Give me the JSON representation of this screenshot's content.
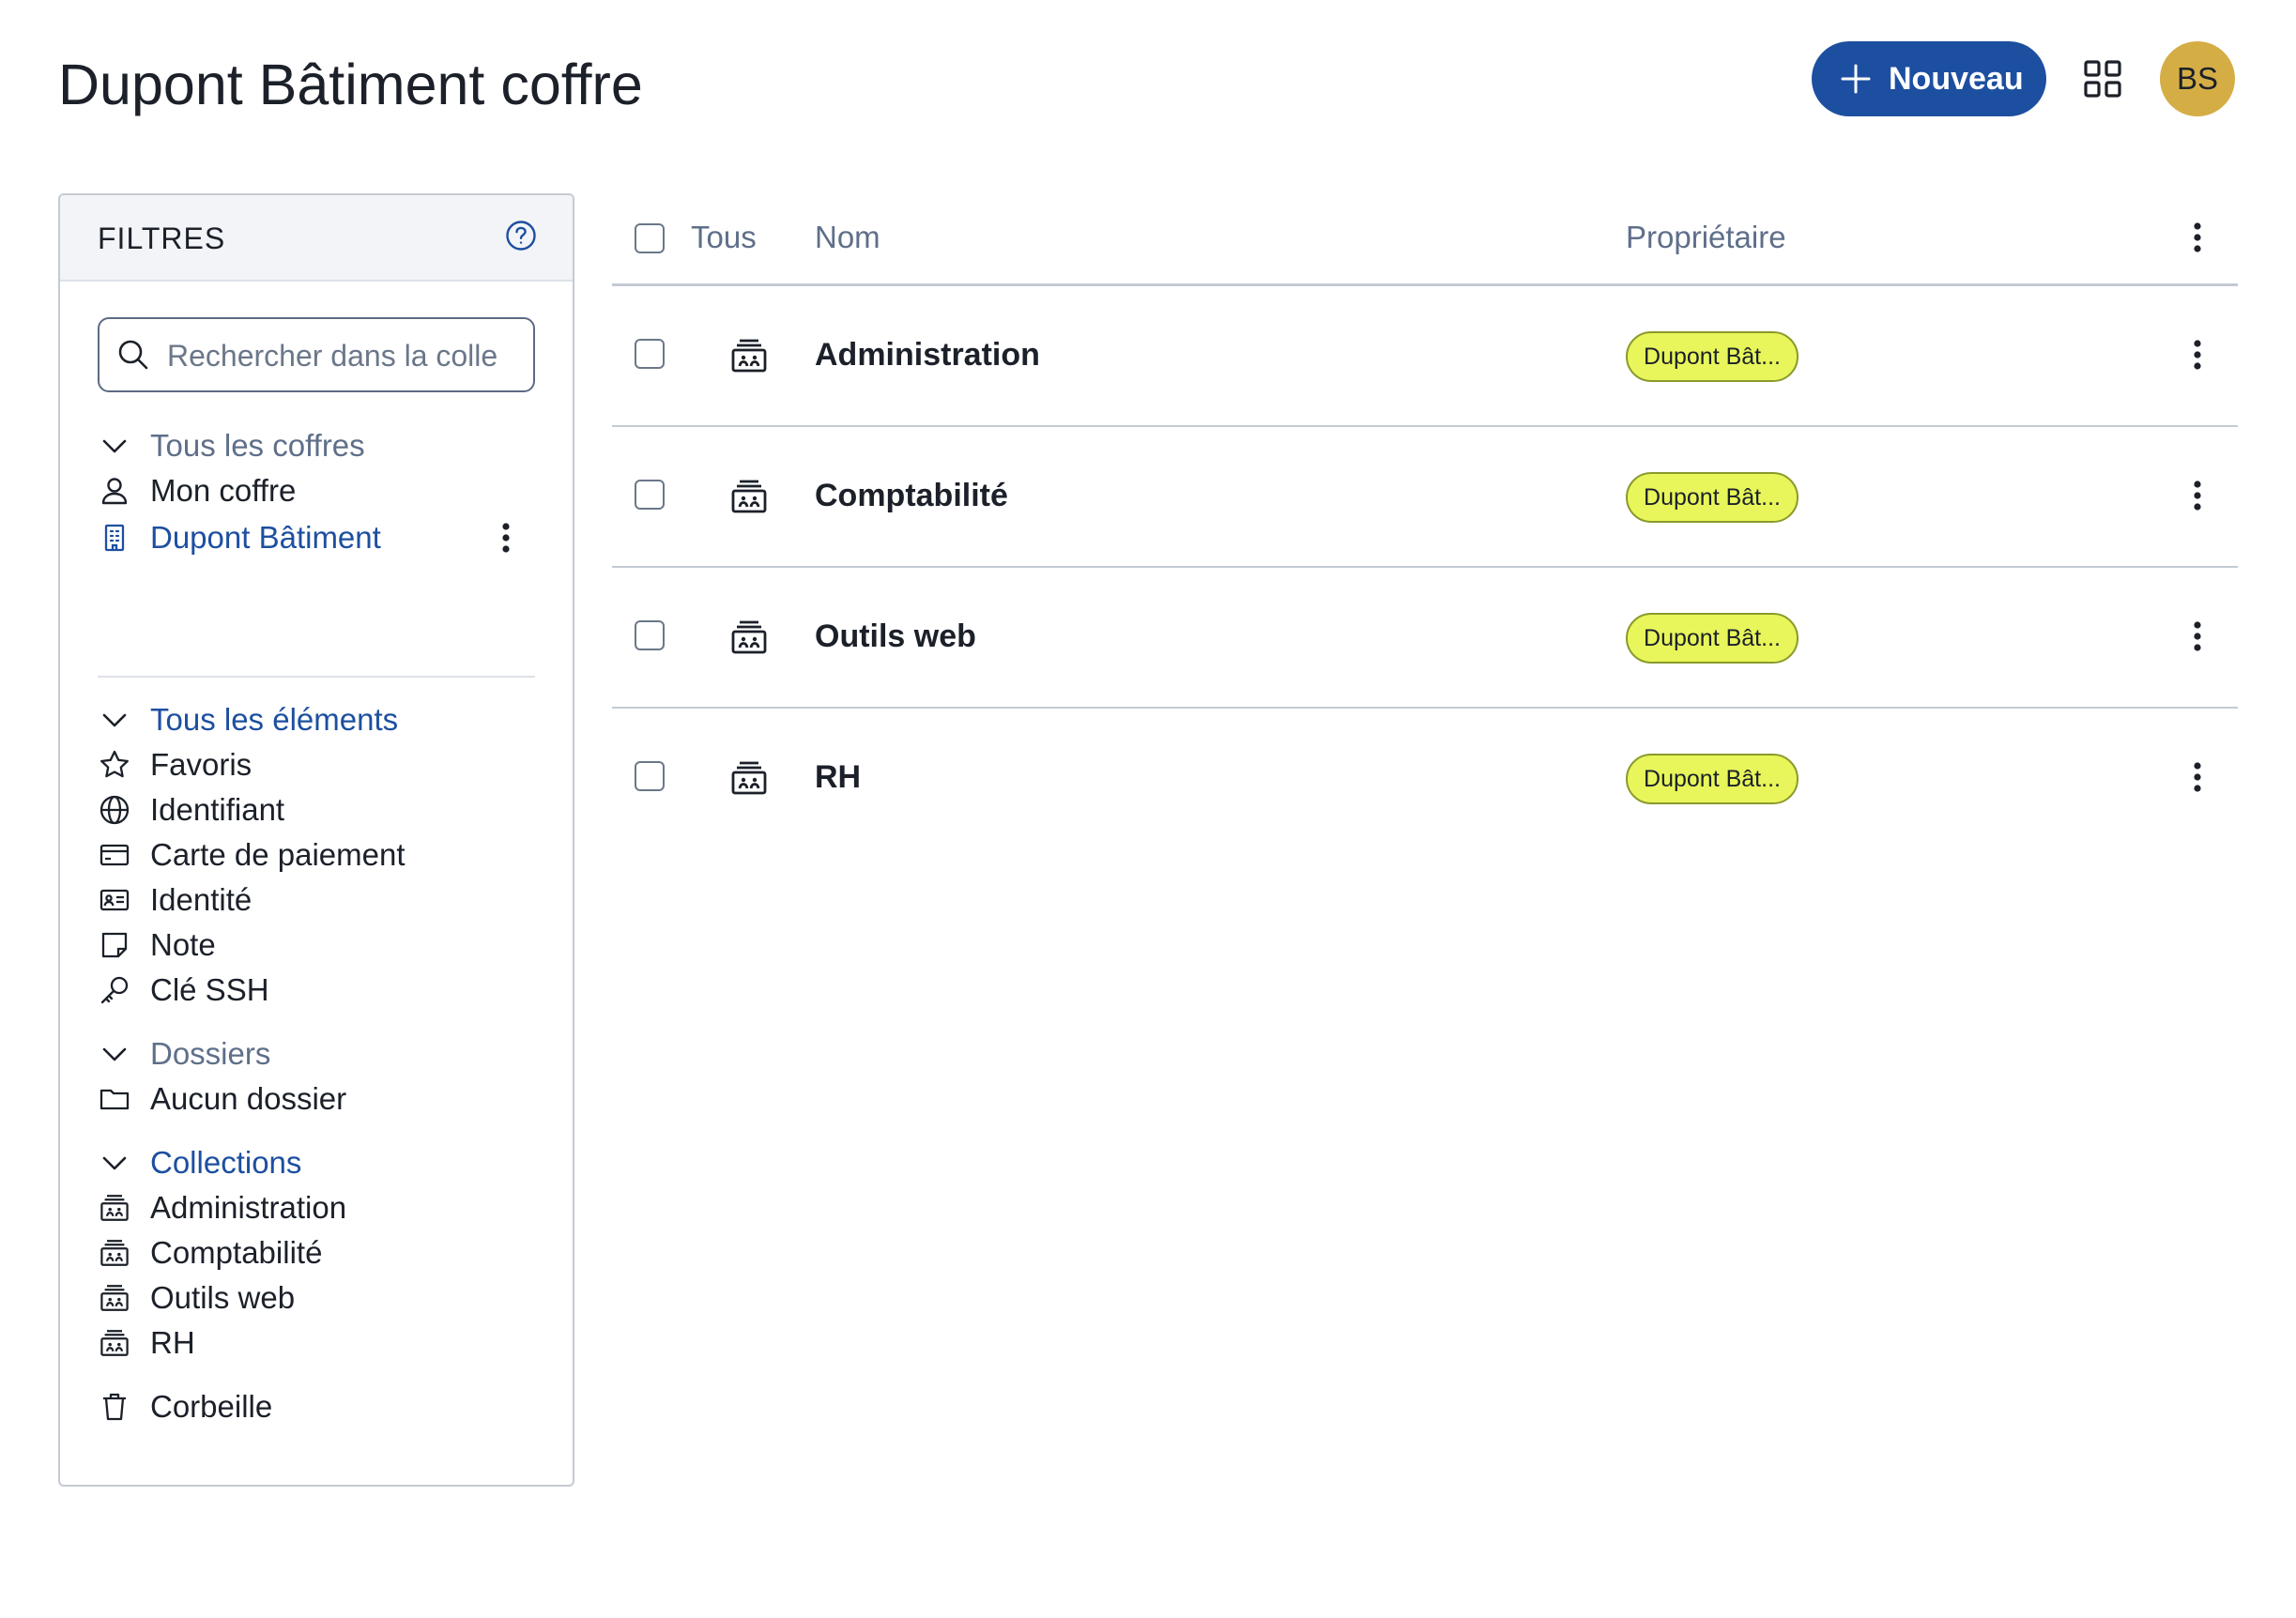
{
  "header": {
    "title": "Dupont Bâtiment coffre",
    "new_button_label": "Nouveau",
    "avatar_initials": "BS"
  },
  "filters": {
    "title": "FILTRES",
    "search_placeholder": "Rechercher dans la colle",
    "vaults": {
      "heading": "Tous les coffres",
      "items": [
        {
          "label": "Mon coffre",
          "icon": "user-icon"
        },
        {
          "label": "Dupont Bâtiment",
          "icon": "building-icon",
          "selected": true
        }
      ]
    },
    "types": {
      "heading": "Tous les éléments",
      "items": [
        {
          "label": "Favoris",
          "icon": "star-icon"
        },
        {
          "label": "Identifiant",
          "icon": "globe-icon"
        },
        {
          "label": "Carte de paiement",
          "icon": "credit-card-icon"
        },
        {
          "label": "Identité",
          "icon": "id-card-icon"
        },
        {
          "label": "Note",
          "icon": "note-icon"
        },
        {
          "label": "Clé SSH",
          "icon": "key-icon"
        }
      ]
    },
    "folders": {
      "heading": "Dossiers",
      "items": [
        {
          "label": "Aucun dossier",
          "icon": "folder-icon"
        }
      ]
    },
    "collections": {
      "heading": "Collections",
      "items": [
        {
          "label": "Administration",
          "icon": "collection-icon"
        },
        {
          "label": "Comptabilité",
          "icon": "collection-icon"
        },
        {
          "label": "Outils web",
          "icon": "collection-icon"
        },
        {
          "label": "RH",
          "icon": "collection-icon"
        }
      ]
    },
    "trash": {
      "label": "Corbeille",
      "icon": "trash-icon"
    }
  },
  "table": {
    "columns": {
      "select_all": "Tous",
      "name": "Nom",
      "owner": "Propriétaire"
    },
    "rows": [
      {
        "name": "Administration",
        "owner": "Dupont Bât..."
      },
      {
        "name": "Comptabilité",
        "owner": "Dupont Bât..."
      },
      {
        "name": "Outils web",
        "owner": "Dupont Bât..."
      },
      {
        "name": "RH",
        "owner": "Dupont Bât..."
      }
    ]
  },
  "colors": {
    "accent": "#1d4fa0",
    "badge": "#e8f65b",
    "avatar": "#d5ad45"
  }
}
